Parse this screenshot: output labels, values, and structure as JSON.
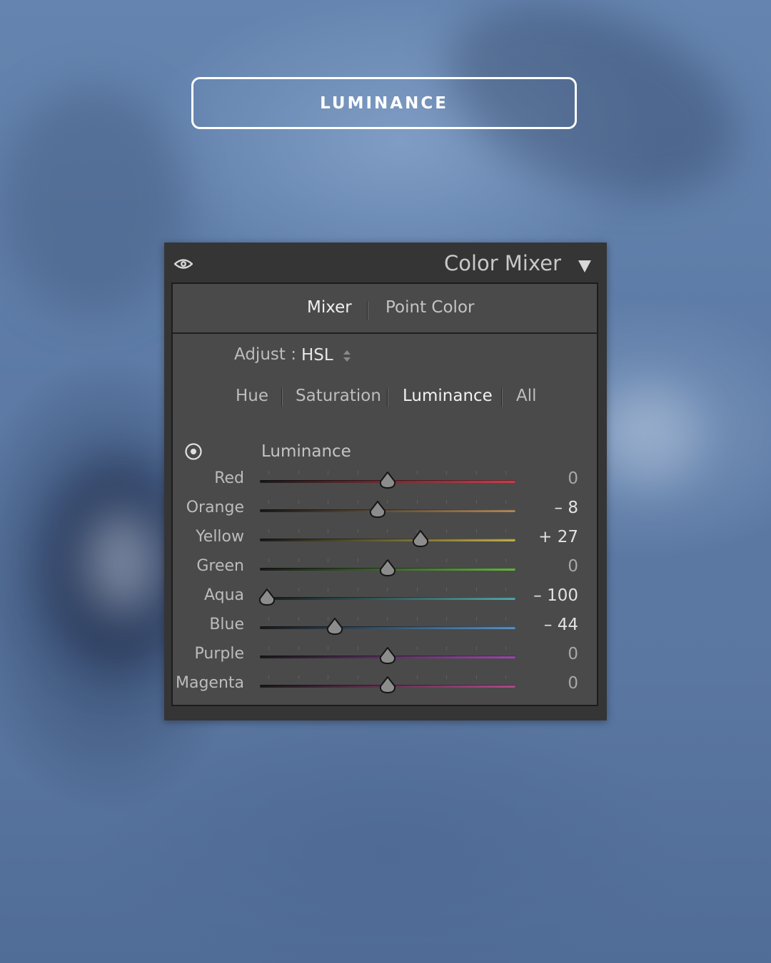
{
  "banner": {
    "title": "LUMINANCE"
  },
  "panel": {
    "title": "Color Mixer",
    "tabs": [
      {
        "label": "Mixer",
        "active": true
      },
      {
        "label": "Point Color",
        "active": false
      }
    ],
    "adjust": {
      "label": "Adjust :",
      "value": "HSL"
    },
    "subtabs": [
      {
        "label": "Hue",
        "active": false
      },
      {
        "label": "Saturation",
        "active": false
      },
      {
        "label": "Luminance",
        "active": true
      },
      {
        "label": "All",
        "active": false
      }
    ],
    "section_label": "Luminance",
    "sliders": [
      {
        "name": "Red",
        "value": 0,
        "display": "0",
        "color": "#c8404e"
      },
      {
        "name": "Orange",
        "value": -8,
        "display": "– 8",
        "color": "#b0885a"
      },
      {
        "name": "Yellow",
        "value": 27,
        "display": "+ 27",
        "color": "#c0b050"
      },
      {
        "name": "Green",
        "value": 0,
        "display": "0",
        "color": "#6ab04a"
      },
      {
        "name": "Aqua",
        "value": -100,
        "display": "– 100",
        "color": "#4fa8a8"
      },
      {
        "name": "Blue",
        "value": -44,
        "display": "– 44",
        "color": "#5a90c0"
      },
      {
        "name": "Purple",
        "value": 0,
        "display": "0",
        "color": "#9a4aa8"
      },
      {
        "name": "Magenta",
        "value": 0,
        "display": "0",
        "color": "#b04a8a"
      }
    ],
    "slider_range": [
      -100,
      100
    ]
  },
  "icons": {
    "visibility": "eye-icon",
    "collapse": "triangle-down-icon",
    "target": "target-adjustment-icon",
    "stepper": "updown-stepper-icon"
  }
}
